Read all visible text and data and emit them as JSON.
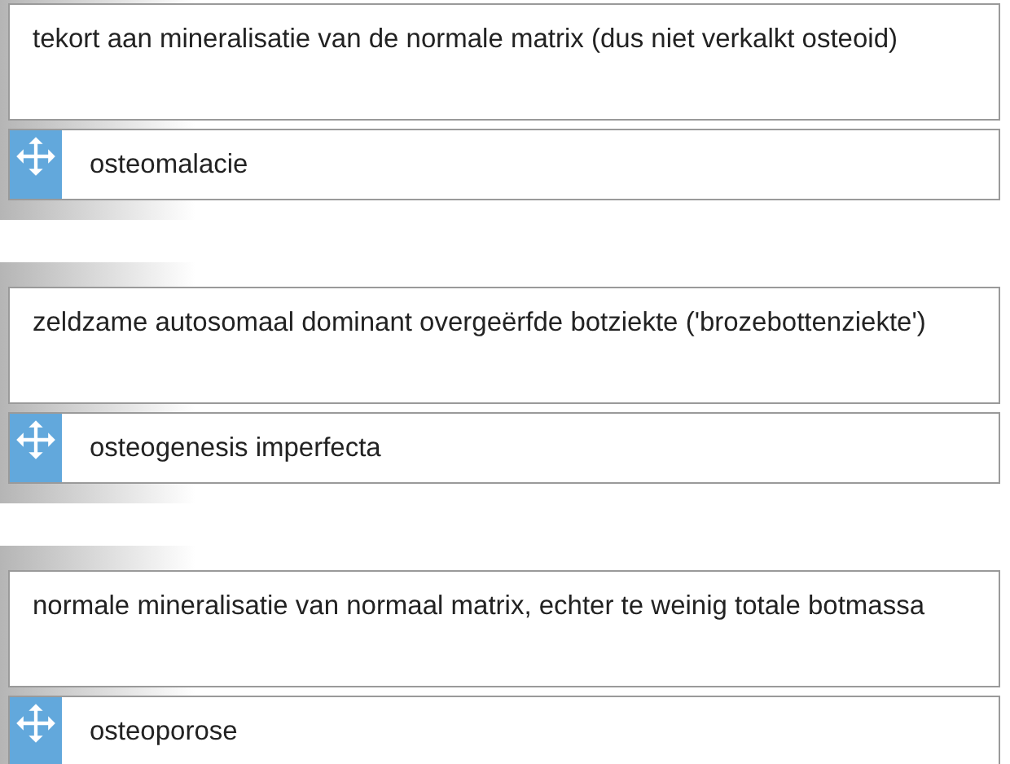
{
  "pairs": [
    {
      "description": "tekort aan mineralisatie van de normale matrix (dus niet verkalkt osteoid)",
      "answer": "osteomalacie"
    },
    {
      "description": "zeldzame autosomaal dominant overgeërfde botziekte ('brozebottenziekte')",
      "answer": "osteogenesis imperfecta"
    },
    {
      "description": "normale mineralisatie van normaal matrix, echter te weinig totale botmassa",
      "answer": "osteoporose"
    }
  ]
}
